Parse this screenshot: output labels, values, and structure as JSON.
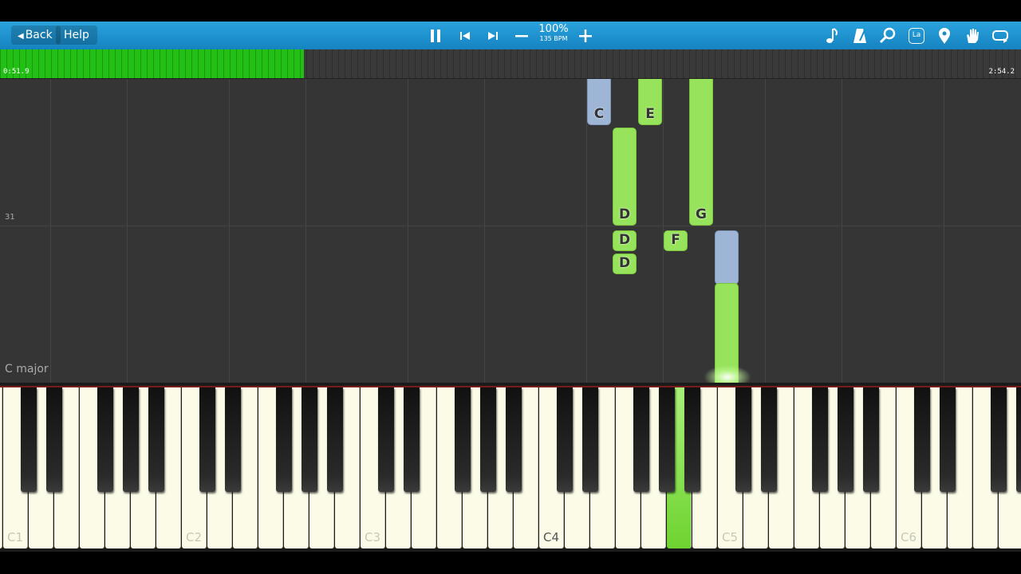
{
  "toolbar": {
    "back_label": "Back",
    "help_label": "Help",
    "tempo_percent": "100%",
    "tempo_bpm": "135 BPM",
    "left_icons": [
      "pause-icon",
      "previous-icon",
      "next-icon",
      "minus-icon",
      "plus-icon"
    ],
    "right_icons": [
      "music-note-icon",
      "metronome-icon",
      "search-icon",
      "la-icon",
      "location-pin-icon",
      "hand-icon",
      "loop-icon"
    ],
    "la_text": "La"
  },
  "progress": {
    "elapsed": "0:51.9",
    "total": "2:54.2",
    "fraction": 0.298
  },
  "roll": {
    "measure_number": "31",
    "key_signature": "C major"
  },
  "notes": [
    {
      "label": "C",
      "color": "blue"
    },
    {
      "label": "E",
      "color": "green"
    },
    {
      "label": "G",
      "color": "green"
    },
    {
      "label": "D",
      "color": "green"
    },
    {
      "label": "D",
      "color": "green"
    },
    {
      "label": "D",
      "color": "green"
    },
    {
      "label": "F",
      "color": "green"
    },
    {
      "label": "",
      "color": "blue"
    },
    {
      "label": "",
      "color": "green"
    }
  ],
  "keyboard": {
    "octave_labels": [
      "C1",
      "C2",
      "C3",
      "C4",
      "C5",
      "C6"
    ],
    "active_key": "A4",
    "active_color": "#7ad93a"
  },
  "colors": {
    "toolbar": "#1e92cf",
    "progress": "#22c014",
    "note_green": "#98e35c",
    "note_blue": "#9eb5d6"
  }
}
